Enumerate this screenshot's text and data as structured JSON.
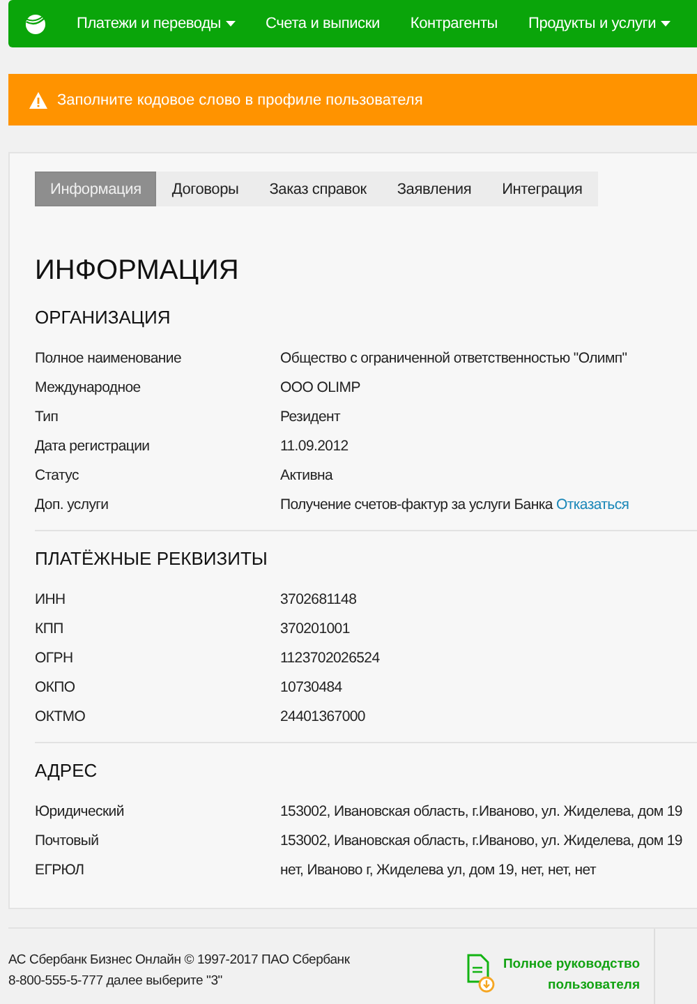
{
  "nav": {
    "items": [
      {
        "label": "Платежи и переводы",
        "dropdown": true
      },
      {
        "label": "Счета и выписки",
        "dropdown": false
      },
      {
        "label": "Контрагенты",
        "dropdown": false
      },
      {
        "label": "Продукты и услуги",
        "dropdown": true
      }
    ]
  },
  "alert": {
    "text": "Заполните кодовое слово в профиле пользователя"
  },
  "tabs": [
    {
      "label": "Информация",
      "selected": true
    },
    {
      "label": "Договоры",
      "selected": false
    },
    {
      "label": "Заказ справок",
      "selected": false
    },
    {
      "label": "Заявления",
      "selected": false
    },
    {
      "label": "Интеграция",
      "selected": false
    }
  ],
  "title": "ИНФОРМАЦИЯ",
  "sections": [
    {
      "heading": "ОРГАНИЗАЦИЯ",
      "rows": [
        {
          "label": "Полное наименование",
          "value": "Общество с ограниченной ответственностью \"Олимп\""
        },
        {
          "label": "Международное",
          "value": "ООО OLIMP"
        },
        {
          "label": "Тип",
          "value": "Резидент"
        },
        {
          "label": "Дата регистрации",
          "value": "11.09.2012"
        },
        {
          "label": "Статус",
          "value": "Активна"
        },
        {
          "label": "Доп. услуги",
          "value": "Получение счетов-фактур за услуги Банка",
          "link": "Отказаться"
        }
      ]
    },
    {
      "heading": "ПЛАТЁЖНЫЕ РЕКВИЗИТЫ",
      "rows": [
        {
          "label": "ИНН",
          "value": "3702681148"
        },
        {
          "label": "КПП",
          "value": "370201001"
        },
        {
          "label": "ОГРН",
          "value": "1123702026524"
        },
        {
          "label": "ОКПО",
          "value": "10730484"
        },
        {
          "label": "ОКТМО",
          "value": "24401367000"
        }
      ]
    },
    {
      "heading": "АДРЕС",
      "rows": [
        {
          "label": "Юридический",
          "value": "153002, Ивановская область, г.Иваново, ул. Жиделева, дом 19"
        },
        {
          "label": "Почтовый",
          "value": "153002, Ивановская область, г.Иваново, ул. Жиделева, дом 19"
        },
        {
          "label": "ЕГРЮЛ",
          "value": "нет, Иваново г, Жиделева ул, дом 19, нет, нет, нет"
        }
      ]
    }
  ],
  "footer": {
    "lines": [
      "АС Сбербанк Бизнес Онлайн © 1997-2017 ПАО Сбербанк",
      "8-800-555-5-777 далее выберите \"3\""
    ],
    "guide": [
      "Полное руководство",
      "пользователя"
    ]
  }
}
